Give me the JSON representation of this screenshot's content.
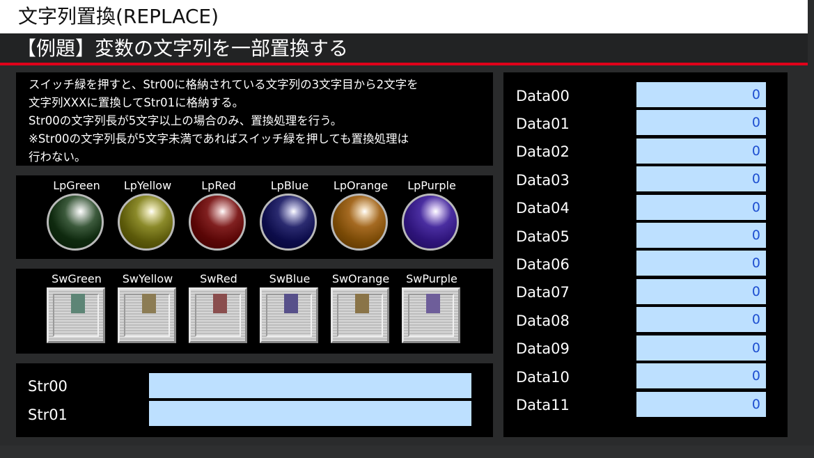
{
  "title": "文字列置換(REPLACE)",
  "subtitle": "【例題】変数の文字列を一部置換する",
  "accent_color": "#e0001a",
  "description": [
    "スイッチ緑を押すと、Str00に格納されている文字列の3文字目から2文字を",
    "文字列XXXに置換してStr01に格納する。",
    "Str00の文字列長が5文字以上の場合のみ、置換処理を行う。",
    "※Str00の文字列長が5文字未満であればスイッチ緑を押しても置換処理は",
    "行わない。"
  ],
  "lamps": [
    {
      "label": "LpGreen",
      "color": "green"
    },
    {
      "label": "LpYellow",
      "color": "yellow"
    },
    {
      "label": "LpRed",
      "color": "red"
    },
    {
      "label": "LpBlue",
      "color": "blue"
    },
    {
      "label": "LpOrange",
      "color": "orange"
    },
    {
      "label": "LpPurple",
      "color": "purple"
    }
  ],
  "switches": [
    {
      "label": "SwGreen",
      "color": "green"
    },
    {
      "label": "SwYellow",
      "color": "yellow"
    },
    {
      "label": "SwRed",
      "color": "red"
    },
    {
      "label": "SwBlue",
      "color": "blue"
    },
    {
      "label": "SwOrange",
      "color": "orange"
    },
    {
      "label": "SwPurple",
      "color": "purple"
    }
  ],
  "strings": [
    {
      "label": "Str00",
      "value": ""
    },
    {
      "label": "Str01",
      "value": ""
    }
  ],
  "data": [
    {
      "label": "Data00",
      "value": "0"
    },
    {
      "label": "Data01",
      "value": "0"
    },
    {
      "label": "Data02",
      "value": "0"
    },
    {
      "label": "Data03",
      "value": "0"
    },
    {
      "label": "Data04",
      "value": "0"
    },
    {
      "label": "Data05",
      "value": "0"
    },
    {
      "label": "Data06",
      "value": "0"
    },
    {
      "label": "Data07",
      "value": "0"
    },
    {
      "label": "Data08",
      "value": "0"
    },
    {
      "label": "Data09",
      "value": "0"
    },
    {
      "label": "Data10",
      "value": "0"
    },
    {
      "label": "Data11",
      "value": "0"
    }
  ]
}
